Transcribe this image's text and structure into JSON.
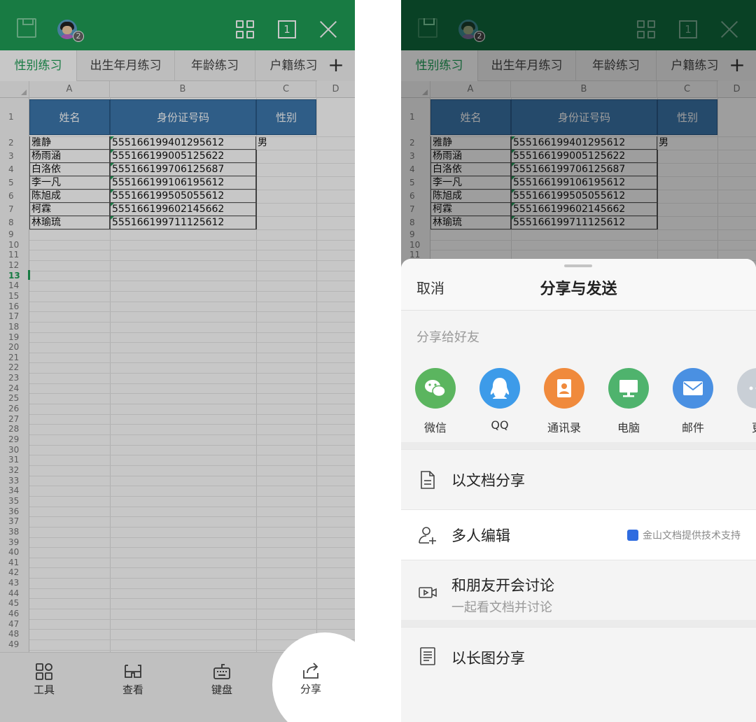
{
  "left": {
    "topbar": {
      "avatar_badge": "2",
      "page_indicator": "1"
    },
    "tabs": [
      "性别练习",
      "出生年月练习",
      "年龄练习",
      "户籍练习"
    ],
    "tab_add": "+",
    "columns": [
      "A",
      "B",
      "C",
      "D"
    ],
    "row_numbers": [
      "1",
      "2",
      "3",
      "4",
      "5",
      "6",
      "7",
      "8",
      "9",
      "10",
      "11",
      "12",
      "13",
      "14",
      "15",
      "16",
      "17",
      "18",
      "19",
      "20",
      "21",
      "22",
      "23",
      "24",
      "25",
      "26",
      "27",
      "28",
      "29",
      "30",
      "31",
      "32",
      "33",
      "34",
      "35",
      "36",
      "37",
      "38",
      "39",
      "40",
      "41",
      "42",
      "43",
      "44",
      "45",
      "46",
      "47",
      "48",
      "49"
    ],
    "selected_row": "13",
    "table": {
      "headers": [
        "姓名",
        "身份证号码",
        "性别"
      ],
      "rows": [
        [
          "雅静",
          "555166199401295612",
          "男"
        ],
        [
          "杨雨涵",
          "555166199005125622",
          ""
        ],
        [
          "白洛依",
          "555166199706125687",
          ""
        ],
        [
          "李一凡",
          "555166199106195612",
          ""
        ],
        [
          "陈旭成",
          "555166199505055612",
          ""
        ],
        [
          "柯霖",
          "555166199602145662",
          ""
        ],
        [
          "林瑜琉",
          "555166199711125612",
          ""
        ]
      ]
    },
    "toolbar": [
      {
        "label": "工具",
        "icon": "tools-grid-icon"
      },
      {
        "label": "查看",
        "icon": "glasses-icon"
      },
      {
        "label": "键盘",
        "icon": "keyboard-icon"
      },
      {
        "label": "分享",
        "icon": "share-icon"
      }
    ]
  },
  "right": {
    "sheet": {
      "cancel": "取消",
      "title": "分享与发送",
      "friends_label": "分享给好友",
      "apps": [
        {
          "name": "微信",
          "icon": "wechat-icon",
          "color": "#5bb55f"
        },
        {
          "name": "QQ",
          "icon": "qq-icon",
          "color": "#3d9be9"
        },
        {
          "name": "通讯录",
          "icon": "contacts-icon",
          "color": "#f08a3c"
        },
        {
          "name": "电脑",
          "icon": "computer-icon",
          "color": "#4fb36d"
        },
        {
          "name": "邮件",
          "icon": "mail-icon",
          "color": "#4a90e2"
        },
        {
          "name": "更",
          "icon": "more-icon",
          "color": "#c9cfd6"
        }
      ],
      "options": {
        "doc_share": "以文档分享",
        "multi_edit": "多人编辑",
        "multi_edit_badge": "金山文档提供技术支持",
        "meeting_title": "和朋友开会讨论",
        "meeting_sub": "一起看文档并讨论",
        "long_image": "以长图分享"
      }
    }
  },
  "colors": {
    "brand_green": "#1f9e57",
    "header_blue": "#3d78ad"
  }
}
